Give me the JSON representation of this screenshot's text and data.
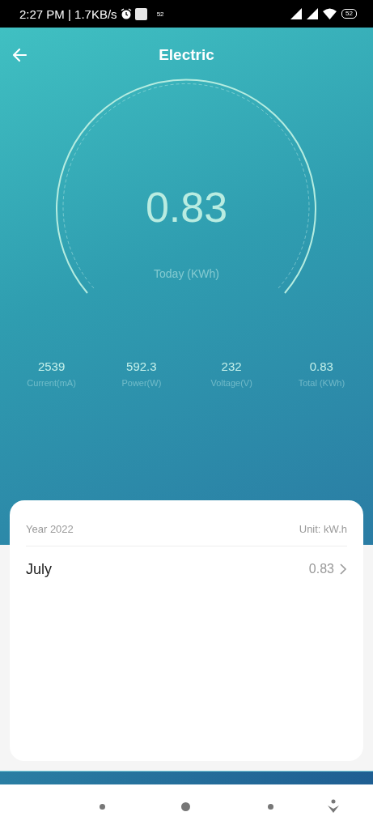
{
  "status_bar": {
    "time_speed": "2:27 PM | 1.7KB/s",
    "notification_count": "52",
    "battery": "52"
  },
  "header": {
    "title": "Electric"
  },
  "gauge": {
    "value": "0.83",
    "label": "Today (KWh)"
  },
  "stats": [
    {
      "value": "2539",
      "label": "Current(mA)"
    },
    {
      "value": "592.3",
      "label": "Power(W)"
    },
    {
      "value": "232",
      "label": "Voltage(V)"
    },
    {
      "value": "0.83",
      "label": "Total (KWh)"
    }
  ],
  "card": {
    "year": "Year 2022",
    "unit": "Unit: kW.h",
    "rows": [
      {
        "month": "July",
        "value": "0.83"
      }
    ]
  }
}
